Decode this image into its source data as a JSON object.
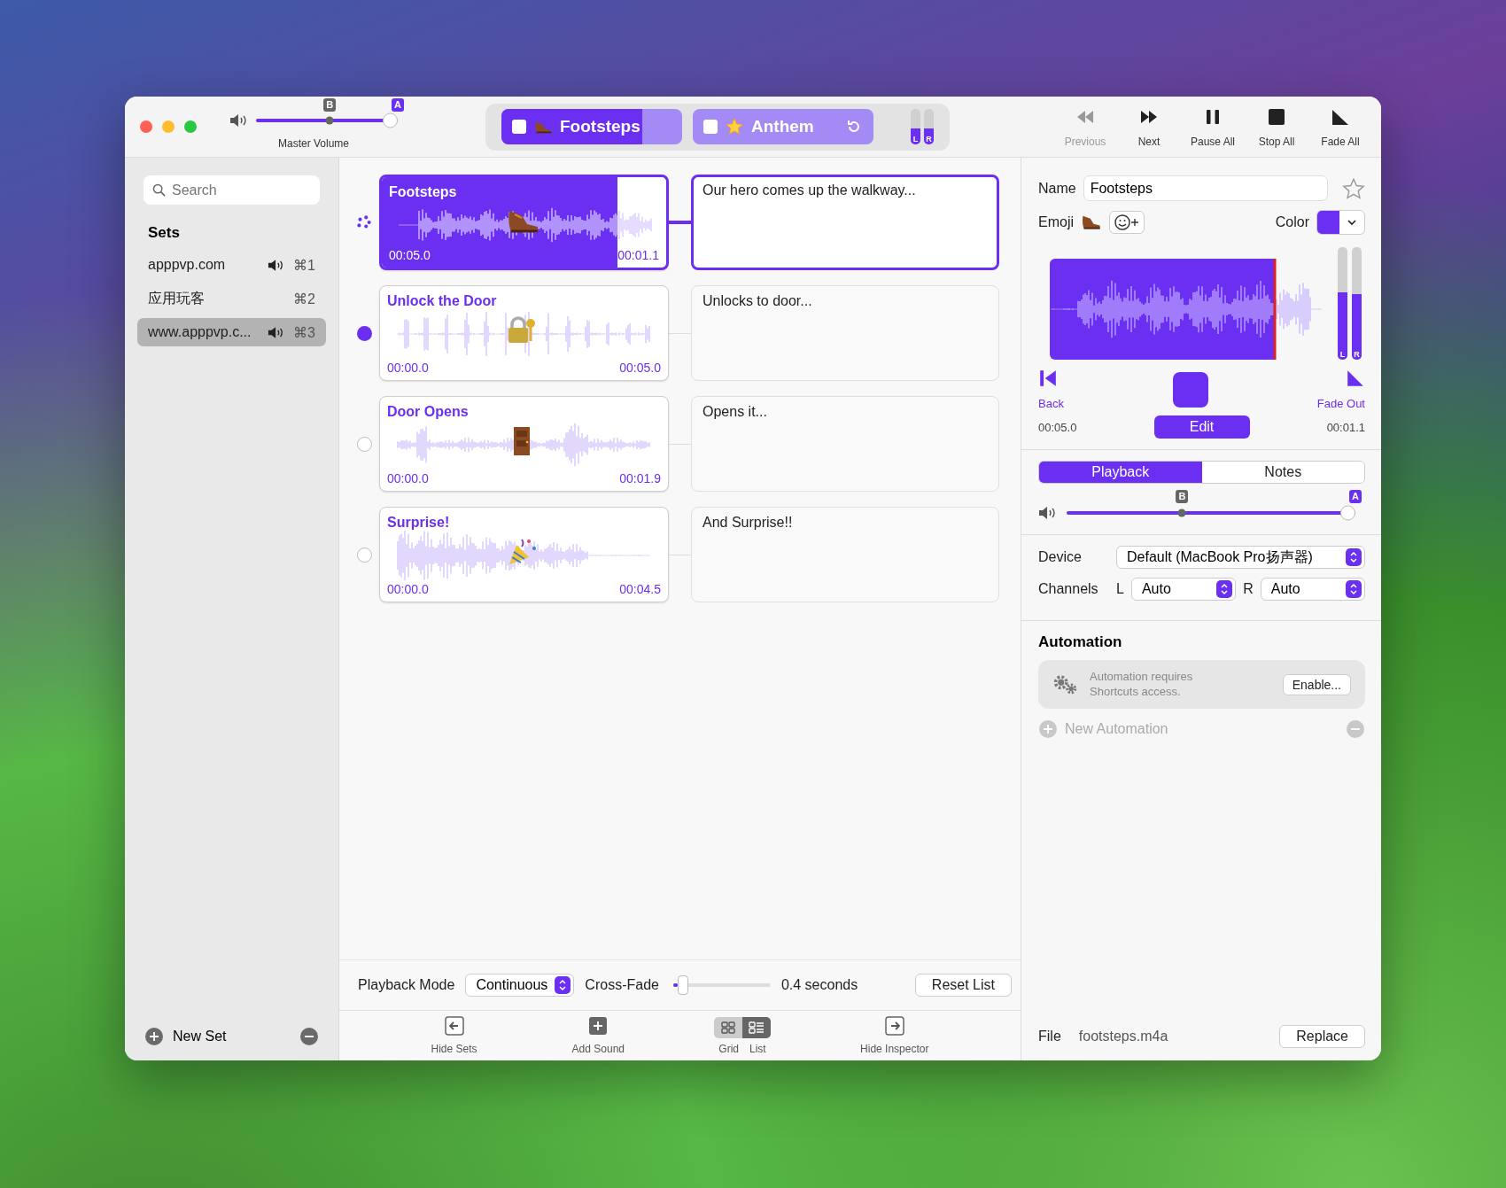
{
  "master_volume": {
    "label": "Master Volume",
    "level": 1.0,
    "markers": [
      {
        "label": "B",
        "level": 0.52
      },
      {
        "label": "A",
        "level": 1.0
      }
    ]
  },
  "now_playing": [
    {
      "label": "Footsteps",
      "checked": false,
      "level": 0.78,
      "loop": false
    },
    {
      "label": "Anthem",
      "checked": false,
      "level": 0.0,
      "loop": true
    }
  ],
  "output_meters": [
    {
      "label": "L",
      "level": 0.45
    },
    {
      "label": "R",
      "level": 0.45
    }
  ],
  "toolbar": [
    {
      "label": "Previous",
      "disabled": true
    },
    {
      "label": "Next",
      "disabled": false
    },
    {
      "label": "Pause All",
      "disabled": false
    },
    {
      "label": "Stop All",
      "disabled": false
    },
    {
      "label": "Fade All",
      "disabled": false
    }
  ],
  "sidebar": {
    "search": {
      "placeholder": "Search"
    },
    "heading": "Sets",
    "items": [
      {
        "label": "apppvp.com",
        "playing": true,
        "shortcut": "⌘1",
        "selected": false
      },
      {
        "label": "应用玩客",
        "playing": false,
        "shortcut": "⌘2",
        "selected": false
      },
      {
        "label": "www.apppvp.c...",
        "playing": true,
        "shortcut": "⌘3",
        "selected": true
      }
    ],
    "new_set": "New Set"
  },
  "cards": [
    {
      "title": "Footsteps",
      "start": "00:05.0",
      "end": "00:01.1",
      "selected": true,
      "level": 0.83,
      "kind": "playing",
      "notes": "Our hero comes up the walkway..."
    },
    {
      "title": "Unlock the Door",
      "start": "00:00.0",
      "end": "00:05.0",
      "selected": false,
      "kind": "next",
      "notes": "Unlocks to door..."
    },
    {
      "title": "Door Opens",
      "start": "00:00.0",
      "end": "00:01.9",
      "selected": false,
      "kind": "idle",
      "notes": "Opens it..."
    },
    {
      "title": "Surprise!",
      "start": "00:00.0",
      "end": "00:04.5",
      "selected": false,
      "kind": "idle",
      "notes": "And Surprise!!"
    }
  ],
  "list_controls": {
    "mode_label": "Playback Mode",
    "mode": "Continuous",
    "crossfade_label": "Cross-Fade",
    "crossfade": {
      "level": 0.05
    },
    "crossfade_value": "0.4 seconds",
    "reset": "Reset List"
  },
  "bottom_toolbar": [
    {
      "kind": "button",
      "label": "Hide Sets"
    },
    {
      "kind": "button",
      "label": "Add Sound"
    },
    {
      "kind": "segmented",
      "options": [
        {
          "label": "Grid",
          "selected": false
        },
        {
          "label": "List",
          "selected": true
        }
      ]
    },
    {
      "kind": "button",
      "label": "Hide Inspector"
    }
  ],
  "inspector": {
    "name_label": "Name",
    "name": "Footsteps",
    "favorite": false,
    "emoji_label": "Emoji",
    "color_label": "Color",
    "color": "#6b2ff2",
    "waveform": {
      "level": 0.82,
      "meters": [
        {
          "label": "L",
          "level": 0.6
        },
        {
          "label": "R",
          "level": 0.58
        }
      ]
    },
    "back": "Back",
    "fade_out": "Fade Out",
    "start": "00:05.0",
    "edit": "Edit",
    "end": "00:01.1",
    "tabs": [
      {
        "label": "Playback",
        "selected": true
      },
      {
        "label": "Notes",
        "selected": false
      }
    ],
    "volume": {
      "level": 1.0,
      "markers": [
        {
          "label": "B",
          "level": 0.4
        },
        {
          "label": "A",
          "level": 1.0
        }
      ]
    },
    "device_label": "Device",
    "device": "Default (MacBook Pro扬声器)",
    "channels_label": "Channels",
    "left_label": "L",
    "left": "Auto",
    "right_label": "R",
    "right": "Auto",
    "automation": {
      "heading": "Automation",
      "message": "Automation requires Shortcuts access.",
      "enable": "Enable...",
      "new": "New Automation",
      "new_disabled": true
    },
    "file_label": "File",
    "file": "footsteps.m4a",
    "replace": "Replace"
  }
}
